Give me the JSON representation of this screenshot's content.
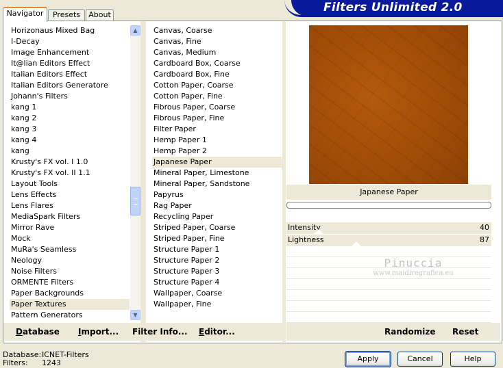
{
  "window": {
    "logo_text": "Filters Unlimited 2.0"
  },
  "tabs": [
    {
      "label": "Navigator",
      "active": true
    },
    {
      "label": "Presets",
      "active": false
    },
    {
      "label": "About",
      "active": false
    }
  ],
  "categories": {
    "items": [
      "Horizonaus Mixed Bag",
      "I-Decay",
      "Image Enhancement",
      "It@lian Editors Effect",
      "Italian Editors Effect",
      "Italian Editors Generatore",
      "Johann's Filters",
      "kang 1",
      "kang 2",
      "kang 3",
      "kang 4",
      "kang",
      "Krusty's FX vol. I 1.0",
      "Krusty's FX vol. II 1.1",
      "Layout Tools",
      "Lens Effects",
      "Lens Flares",
      "MediaSpark Filters",
      "Mirror Rave",
      "Mock",
      "MuRa's Seamless",
      "Neology",
      "Noise Filters",
      "ORMENTE Filters",
      "Paper Backgrounds",
      "Paper Textures",
      "Pattern Generators"
    ],
    "selected": "Paper Textures"
  },
  "filters": {
    "items": [
      "Canvas, Coarse",
      "Canvas, Fine",
      "Canvas, Medium",
      "Cardboard Box, Coarse",
      "Cardboard Box, Fine",
      "Cotton Paper, Coarse",
      "Cotton Paper, Fine",
      "Fibrous Paper, Coarse",
      "Fibrous Paper, Fine",
      "Filter Paper",
      "Hemp Paper 1",
      "Hemp Paper 2",
      "Japanese Paper",
      "Mineral Paper, Limestone",
      "Mineral Paper, Sandstone",
      "Papyrus",
      "Rag Paper",
      "Recycling Paper",
      "Striped Paper, Coarse",
      "Striped Paper, Fine",
      "Structure Paper 1",
      "Structure Paper 2",
      "Structure Paper 3",
      "Structure Paper 4",
      "Wallpaper, Coarse",
      "Wallpaper, Fine"
    ],
    "selected": "Japanese Paper"
  },
  "preview": {
    "filter_name": "Japanese Paper",
    "texture_color": "#9f4c08"
  },
  "controls": [
    {
      "label": "Intensity",
      "value": "40",
      "fraction": 0.157
    },
    {
      "label": "Lightness",
      "value": "87",
      "fraction": 0.341
    }
  ],
  "watermark": {
    "line1": "Pinuccia",
    "line2": "www.maidiregrafica.eu"
  },
  "left_buttons": [
    {
      "text": "Database",
      "ul": "D"
    },
    {
      "text": "Import...",
      "ul": "I"
    },
    {
      "text": "Filter Info...",
      "ul": ""
    },
    {
      "text": "Editor...",
      "ul": "E"
    }
  ],
  "right_buttons": [
    {
      "text": "Randomize"
    },
    {
      "text": "Reset"
    }
  ],
  "dialog_buttons": {
    "apply": "Apply",
    "cancel": "Cancel",
    "help": "Help"
  },
  "info": {
    "database_label": "Database:",
    "database_value": "ICNET-Filters",
    "filters_label": "Filters:",
    "filters_value": "1243"
  }
}
